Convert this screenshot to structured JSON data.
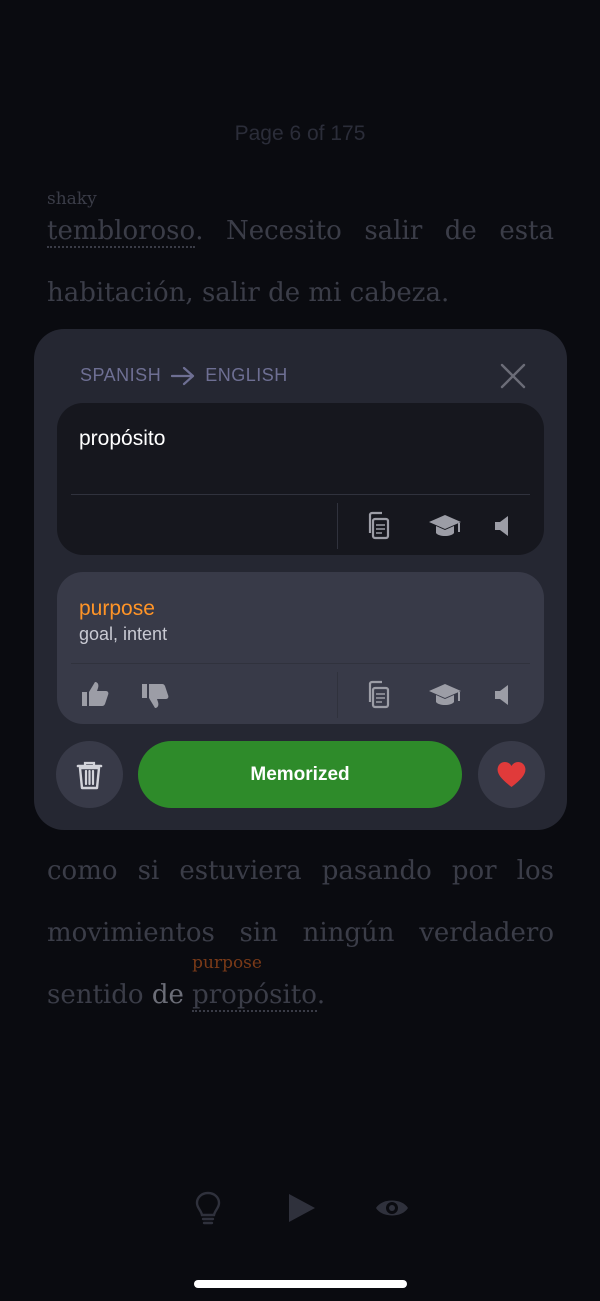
{
  "reader": {
    "page_indicator": "Page 6 of 175",
    "para_top": {
      "word1": "tembloroso",
      "word1_gloss": "shaky",
      "line1_rest": ". Necesito salir de esta",
      "line2": "habitación, salir de mi cabeza."
    },
    "para_bottom": {
      "line1": "como si estuviera pasando por los",
      "line2": "movimientos sin ningún verdadero",
      "line3_pre": "sentido",
      "line3_de": "de",
      "word2": "propósito",
      "word2_gloss": "purpose",
      "line3_end": "."
    }
  },
  "popup": {
    "source_lang": "SPANISH",
    "target_lang": "ENGLISH",
    "source_word": "propósito",
    "target_word": "purpose",
    "target_synonyms": "goal, intent",
    "memorized_label": "Memorized"
  },
  "icons": {
    "close": "close-icon",
    "copy": "copy-icon",
    "learn": "graduation-cap-icon",
    "speaker": "speaker-icon",
    "thumbs_up": "thumbs-up-icon",
    "thumbs_down": "thumbs-down-icon",
    "trash": "trash-icon",
    "heart": "heart-icon",
    "lightbulb": "lightbulb-icon",
    "play": "play-icon",
    "eye": "eye-icon"
  },
  "colors": {
    "accent_orange": "#ff9427",
    "memorized_green": "#2e8b2a",
    "heart_red": "#e03a3a"
  }
}
